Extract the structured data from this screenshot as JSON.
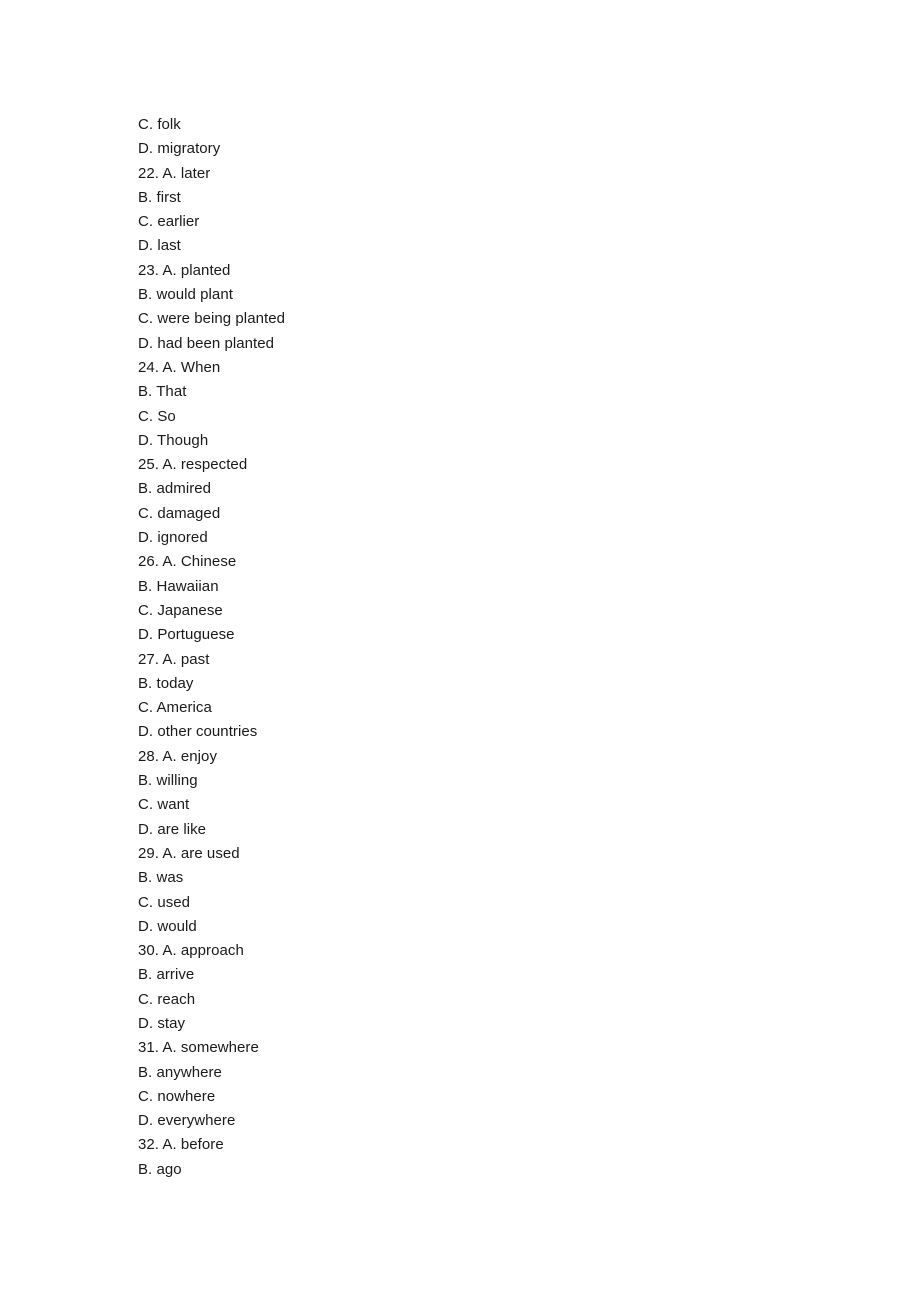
{
  "document": {
    "background_color": "#ffffff",
    "text_color": "#1a1a1a",
    "lines": [
      {
        "text": "C. folk"
      },
      {
        "text": "D. migratory"
      },
      {
        "text": "22. A. later"
      },
      {
        "text": "B. first"
      },
      {
        "text": "C. earlier"
      },
      {
        "text": "D. last"
      },
      {
        "text": "23. A. planted"
      },
      {
        "text": "B. would plant"
      },
      {
        "text": "C. were being planted"
      },
      {
        "text": "D. had been planted"
      },
      {
        "text": "24. A. When"
      },
      {
        "text": "B. That"
      },
      {
        "text": "C. So"
      },
      {
        "text": "D. Though"
      },
      {
        "text": "25. A. respected"
      },
      {
        "text": "B. admired"
      },
      {
        "text": "C. damaged"
      },
      {
        "text": "D. ignored"
      },
      {
        "text": "26. A. Chinese"
      },
      {
        "text": "B. Hawaiian"
      },
      {
        "text": "C. Japanese"
      },
      {
        "text": "D. Portuguese"
      },
      {
        "text": "27. A. past"
      },
      {
        "text": "B. today"
      },
      {
        "text": "C. America"
      },
      {
        "text": "D. other countries"
      },
      {
        "text": "28. A. enjoy"
      },
      {
        "text": "B. willing"
      },
      {
        "text": "C. want"
      },
      {
        "text": "D. are like"
      },
      {
        "text": "29. A. are used"
      },
      {
        "text": "B. was"
      },
      {
        "text": "C. used"
      },
      {
        "text": "D. would"
      },
      {
        "text": "30. A. approach"
      },
      {
        "text": "B. arrive"
      },
      {
        "text": "C. reach"
      },
      {
        "text": "D. stay"
      },
      {
        "text": "31. A. somewhere"
      },
      {
        "text": "B. anywhere"
      },
      {
        "text": "C. nowhere"
      },
      {
        "text": "D. everywhere"
      },
      {
        "text": "32. A. before"
      },
      {
        "text": "B. ago"
      }
    ]
  }
}
